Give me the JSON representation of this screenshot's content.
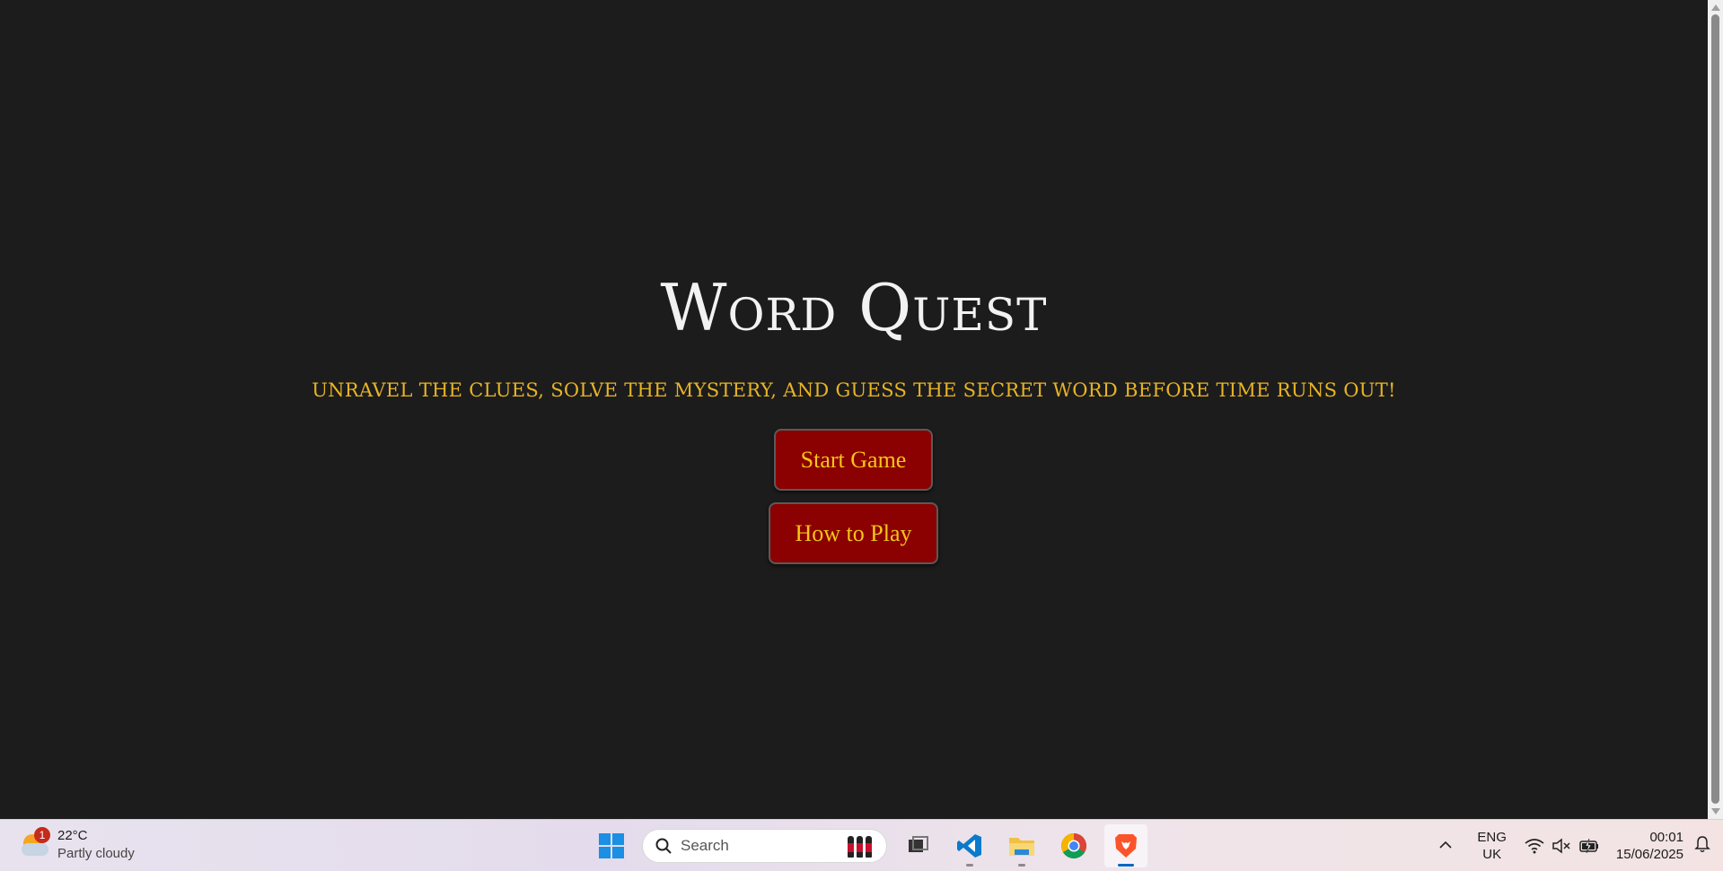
{
  "game": {
    "title": "Word Quest",
    "subtitle": "Unravel the clues, solve the mystery, and guess the secret word before time runs out!",
    "start_label": "Start Game",
    "how_label": "How to Play"
  },
  "colors": {
    "background": "#1c1c1c",
    "title": "#f2f2f2",
    "subtitle": "#e8b425",
    "button_bg": "#8b0000",
    "button_text": "#f5c518"
  },
  "taskbar": {
    "weather": {
      "badge": "1",
      "temp": "22°C",
      "condition": "Partly cloudy",
      "icon": "partly-cloudy-icon"
    },
    "search": {
      "label": "Search",
      "icon": "search-icon"
    },
    "apps": [
      {
        "name": "Task View",
        "icon": "task-view-icon"
      },
      {
        "name": "Visual Studio Code",
        "icon": "vscode-icon"
      },
      {
        "name": "File Explorer",
        "icon": "file-explorer-icon"
      },
      {
        "name": "Google Chrome",
        "icon": "chrome-icon"
      },
      {
        "name": "Brave",
        "icon": "brave-icon"
      }
    ],
    "language": {
      "line1": "ENG",
      "line2": "UK"
    },
    "clock": {
      "time": "00:01",
      "date": "15/06/2025"
    }
  }
}
